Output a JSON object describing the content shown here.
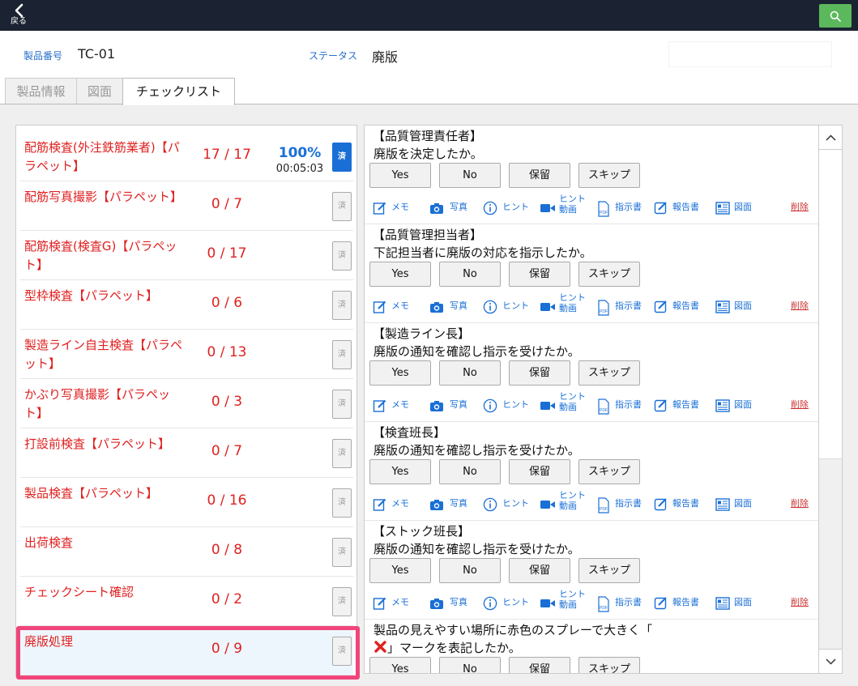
{
  "header": {
    "back_label": "戻る"
  },
  "info": {
    "product_no_label": "製品番号",
    "product_no": "TC-01",
    "status_label": "ステータス",
    "status": "廃版"
  },
  "tabs": [
    {
      "label": "製品情報"
    },
    {
      "label": "図面"
    },
    {
      "label": "チェックリスト"
    }
  ],
  "checklist": [
    {
      "name": "配筋検査(外注鉄筋業者)【パラペット】",
      "count": "17 / 17",
      "percent": "100%",
      "time": "00:05:03",
      "done_label": "済",
      "done": true
    },
    {
      "name": "配筋写真撮影【パラペット】",
      "count": "0 / 7",
      "done_label": "済",
      "done": false
    },
    {
      "name": "配筋検査(検査G)【パラペット】",
      "count": "0 / 17",
      "done_label": "済",
      "done": false
    },
    {
      "name": "型枠検査【パラペット】",
      "count": "0 / 6",
      "done_label": "済",
      "done": false
    },
    {
      "name": "製造ライン自主検査【パラペット】",
      "count": "0 / 13",
      "done_label": "済",
      "done": false
    },
    {
      "name": "かぶり写真撮影【パラペット】",
      "count": "0 / 3",
      "done_label": "済",
      "done": false
    },
    {
      "name": "打設前検査【パラペット】",
      "count": "0 / 7",
      "done_label": "済",
      "done": false
    },
    {
      "name": "製品検査【パラペット】",
      "count": "0 / 16",
      "done_label": "済",
      "done": false
    },
    {
      "name": "出荷検査",
      "count": "0 / 8",
      "done_label": "済",
      "done": false
    },
    {
      "name": "チェックシート確認",
      "count": "0 / 2",
      "done_label": "済",
      "done": false
    },
    {
      "name": "廃版処理",
      "count": "0 / 9",
      "done_label": "済",
      "done": false
    }
  ],
  "buttons": {
    "yes": "Yes",
    "no": "No",
    "hold": "保留",
    "skip": "スキップ"
  },
  "actions": {
    "memo": "メモ",
    "photo": "写真",
    "hint": "ヒント",
    "hint_video_1": "ヒント",
    "hint_video_2": "動画",
    "instruction": "指示書",
    "report": "報告書",
    "drawing": "図面",
    "delete": "削除"
  },
  "questions": [
    {
      "role": "【品質管理責任者】",
      "text": "廃版を決定したか。"
    },
    {
      "role": "【品質管理担当者】",
      "text": "下記担当者に廃版の対応を指示したか。"
    },
    {
      "role": "【製造ライン長】",
      "text": "廃版の通知を確認し指示を受けたか。"
    },
    {
      "role": "【検査班長】",
      "text": "廃版の通知を確認し指示を受けたか。"
    },
    {
      "role": "【ストック班長】",
      "text": "廃版の通知を確認し指示を受けたか。"
    }
  ],
  "last_question": {
    "line1": "製品の見えやすい場所に赤色のスプレーで大きく「",
    "line2": "」マークを表記したか。"
  },
  "colors": {
    "accent": "#1a6fd6",
    "alert": "#e02020",
    "highlight": "#f0457b",
    "topbar": "#1b2332",
    "search": "#5cb85c"
  }
}
